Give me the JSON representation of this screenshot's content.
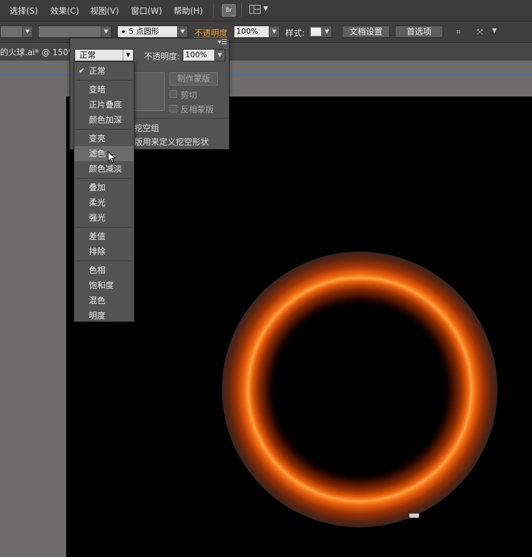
{
  "menubar": {
    "items": [
      "选择(S)",
      "效果(C)",
      "视图(V)",
      "窗口(W)",
      "帮助(H)"
    ],
    "bridge_label": "Br"
  },
  "control_bar": {
    "stroke_profile": "5 点圆形",
    "opacity_label": "不透明度",
    "opacity_value": "100%",
    "style_label": "样式:",
    "doc_settings": "文档设置",
    "preferences": "首选项"
  },
  "document": {
    "tab_title": "的火球.ai* @ 150%"
  },
  "transparency_panel": {
    "blend_mode": "正常",
    "opacity_label": "不透明度:",
    "opacity_value": "100%",
    "make_mask": "制作蒙版",
    "clip": "剪切",
    "invert_mask": "反相蒙版",
    "knockout_group": "挖空组",
    "opacity_mask_knockout": "版用来定义挖空形状"
  },
  "blend_dropdown": {
    "items": [
      {
        "label": "正常",
        "checked": true
      },
      {
        "label": "变暗"
      },
      {
        "label": "正片叠底"
      },
      {
        "label": "颜色加深"
      },
      {
        "label": "变亮"
      },
      {
        "label": "滤色",
        "hover": true
      },
      {
        "label": "颜色减淡"
      },
      {
        "label": "叠加"
      },
      {
        "label": "柔光"
      },
      {
        "label": "强光"
      },
      {
        "label": "差值"
      },
      {
        "label": "排除"
      },
      {
        "label": "色相"
      },
      {
        "label": "饱和度"
      },
      {
        "label": "混色"
      },
      {
        "label": "明度"
      }
    ]
  },
  "colors": {
    "accent_label": "#e7a03c",
    "ring_core": "#ff9a2a",
    "ring_outer": "#6b1c00",
    "canvas": "#000000"
  }
}
